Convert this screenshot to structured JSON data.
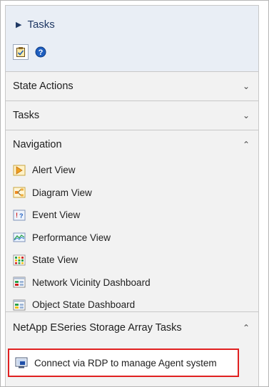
{
  "header": {
    "title": "Tasks",
    "tab_icons": [
      "tasks-icon",
      "help-icon"
    ]
  },
  "sections": {
    "state_actions": {
      "label": "State Actions",
      "expanded": false
    },
    "tasks": {
      "label": "Tasks",
      "expanded": false
    },
    "navigation": {
      "label": "Navigation",
      "expanded": true,
      "items": [
        {
          "label": "Alert View",
          "icon": "alert-view-icon"
        },
        {
          "label": "Diagram View",
          "icon": "diagram-view-icon"
        },
        {
          "label": "Event View",
          "icon": "event-view-icon"
        },
        {
          "label": "Performance View",
          "icon": "performance-view-icon"
        },
        {
          "label": "State View",
          "icon": "state-view-icon"
        },
        {
          "label": "Network Vicinity Dashboard",
          "icon": "dashboard-icon"
        },
        {
          "label": "Object State Dashboard",
          "icon": "dashboard-icon"
        }
      ]
    },
    "netapp": {
      "label": "NetApp ESeries Storage Array Tasks",
      "expanded": true,
      "items": [
        {
          "label": "Connect via RDP to manage Agent system",
          "icon": "remote-desktop-icon",
          "highlighted": true
        }
      ]
    }
  },
  "colors": {
    "highlight": "#e02020",
    "header_bg": "#e9eef5",
    "panel_bg": "#f2f2f2"
  }
}
